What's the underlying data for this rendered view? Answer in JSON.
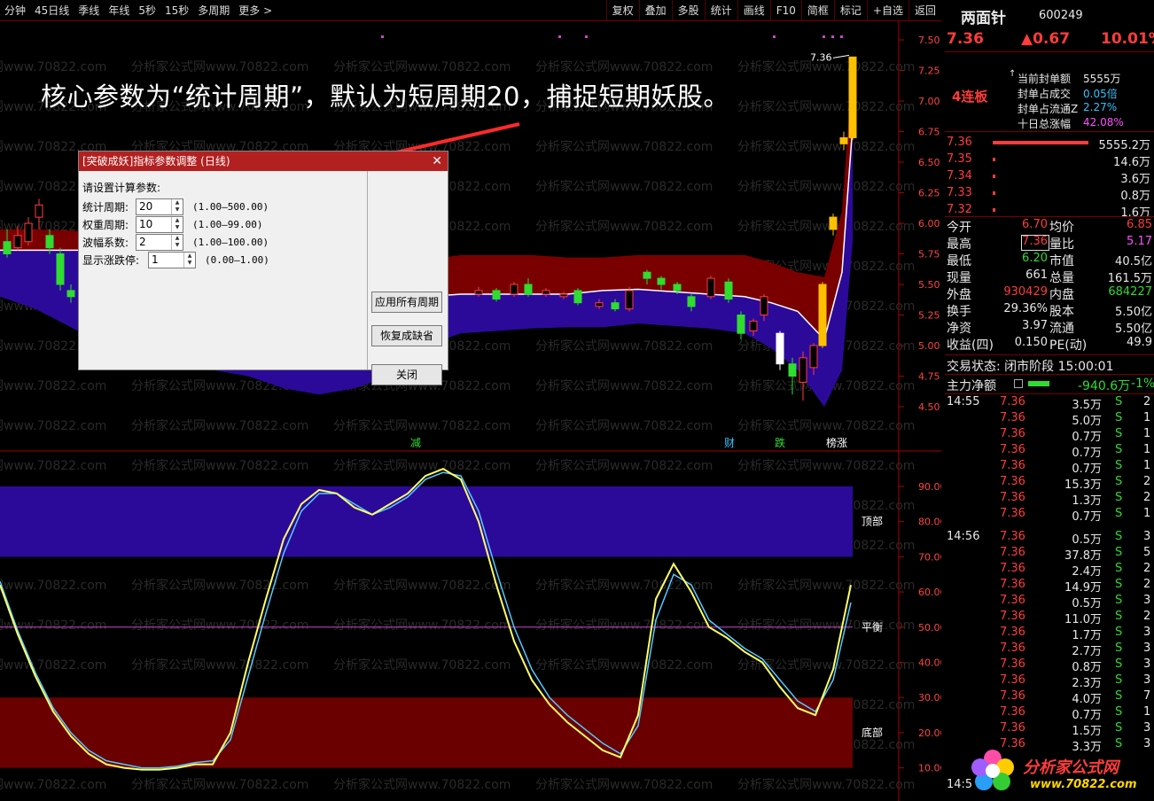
{
  "toolbar": {
    "left": [
      "分钟",
      "45日线",
      "季线",
      "年线",
      "5秒",
      "15秒",
      "多周期",
      "更多 >"
    ],
    "right": [
      "复权",
      "叠加",
      "多股",
      "统计",
      "画线",
      "F10",
      "简框",
      "标记",
      "+自选",
      "返回"
    ]
  },
  "caption": "核心参数为“统计周期”，默认为短周期20，捕捉短期妖股。",
  "watermark": "分析家公式网www.70822.com",
  "price_axis": [
    "7.50",
    "7.25",
    "7.00",
    "6.75",
    "6.50",
    "6.25",
    "6.00",
    "5.75",
    "5.50",
    "5.25",
    "5.00",
    "4.75",
    "4.50"
  ],
  "osc_axis": [
    "90.00",
    "80.00",
    "70.00",
    "60.00",
    "50.00",
    "40.00",
    "30.00",
    "20.00",
    "10.00"
  ],
  "osc_labels": {
    "top": "顶部",
    "mid": "平衡",
    "bottom": "底部"
  },
  "price_tag": "7.36",
  "signals": [
    {
      "text": "减",
      "color": "#2fdc2f"
    },
    {
      "text": "财",
      "color": "#33c3ff"
    },
    {
      "text": "跌",
      "color": "#2fdc2f"
    },
    {
      "text": "榜涨",
      "color": "#ffffff"
    }
  ],
  "dialog": {
    "title": "[突破成妖]指标参数调整 (日线)",
    "close": "✕",
    "prompt": "请设置计算参数:",
    "params": [
      {
        "label": "统计周期:",
        "value": "20",
        "range": "(1.00—500.00)"
      },
      {
        "label": "权重周期:",
        "value": "10",
        "range": "(1.00—99.00)"
      },
      {
        "label": "波幅系数:",
        "value": "2",
        "range": "(1.00—100.00)"
      },
      {
        "label": "显示涨跌停:",
        "value": "1",
        "range": "(0.00—1.00)"
      }
    ],
    "buttons": [
      "应用所有周期",
      "恢复成缺省",
      "关闭"
    ]
  },
  "stock": {
    "name": "两面针",
    "code": "600249",
    "price": "7.36",
    "change": "▲0.67",
    "pct": "10.01%",
    "board": "4连板",
    "seal": [
      {
        "label": "当前封单额",
        "value": "5555万",
        "color": "#e8e8e8"
      },
      {
        "label": "封单占成交",
        "value": "0.05倍",
        "color": "#33c3ff"
      },
      {
        "label": "封单占流通Z",
        "value": "2.27%",
        "color": "#33c3ff"
      },
      {
        "label": "十日总涨幅",
        "value": "42.08%",
        "color": "#ff50ff"
      }
    ],
    "orderbook": [
      {
        "price": "7.36",
        "vol": "5555.2万"
      },
      {
        "price": "7.35",
        "vol": "14.6万"
      },
      {
        "price": "7.34",
        "vol": "3.6万"
      },
      {
        "price": "7.33",
        "vol": "0.8万"
      },
      {
        "price": "7.32",
        "vol": "1.6万"
      }
    ],
    "stats": [
      [
        {
          "l": "今开",
          "v": "6.70",
          "c": "#ff3c3c"
        },
        {
          "l": "均价",
          "v": "6.85",
          "c": "#ff3c3c"
        }
      ],
      [
        {
          "l": "最高",
          "v": "7.36",
          "c": "#ff3c3c"
        },
        {
          "l": "量比",
          "v": "5.17",
          "c": "#ff50ff"
        }
      ],
      [
        {
          "l": "最低",
          "v": "6.20",
          "c": "#2fdc2f"
        },
        {
          "l": "市值",
          "v": "40.5亿",
          "c": "#e8e8e8"
        }
      ],
      [
        {
          "l": "现量",
          "v": "661",
          "c": "#e8e8e8"
        },
        {
          "l": "总量",
          "v": "161.5万",
          "c": "#e8e8e8"
        }
      ],
      [
        {
          "l": "外盘",
          "v": "930429",
          "c": "#ff3c3c"
        },
        {
          "l": "内盘",
          "v": "684227",
          "c": "#2fdc2f"
        }
      ],
      [
        {
          "l": "换手",
          "v": "29.36%",
          "c": "#e8e8e8"
        },
        {
          "l": "股本",
          "v": "5.50亿",
          "c": "#e8e8e8"
        }
      ],
      [
        {
          "l": "净资",
          "v": "3.97",
          "c": "#e8e8e8"
        },
        {
          "l": "流通",
          "v": "5.50亿",
          "c": "#e8e8e8"
        }
      ],
      [
        {
          "l": "收益(四)",
          "v": "0.150",
          "c": "#e8e8e8"
        },
        {
          "l": "PE(动)",
          "v": "49.9",
          "c": "#e8e8e8"
        }
      ]
    ],
    "trade_status": "交易状态: 闭市阶段 15:00:01",
    "main_flow": {
      "label": "主力净额",
      "value": "-940.6万",
      "pct": "-1%"
    },
    "ticks": [
      {
        "t": "14:55",
        "p": "7.36",
        "v": "3.5万",
        "s": "S",
        "n": "2"
      },
      {
        "t": "",
        "p": "7.36",
        "v": "5.0万",
        "s": "S",
        "n": "1"
      },
      {
        "t": "",
        "p": "7.36",
        "v": "0.7万",
        "s": "S",
        "n": "1"
      },
      {
        "t": "",
        "p": "7.36",
        "v": "0.7万",
        "s": "S",
        "n": "1"
      },
      {
        "t": "",
        "p": "7.36",
        "v": "0.7万",
        "s": "S",
        "n": "1"
      },
      {
        "t": "",
        "p": "7.36",
        "v": "15.3万",
        "s": "S",
        "n": "2"
      },
      {
        "t": "",
        "p": "7.36",
        "v": "1.3万",
        "s": "S",
        "n": "2"
      },
      {
        "t": "",
        "p": "7.36",
        "v": "0.7万",
        "s": "S",
        "n": "1"
      },
      {
        "t": "14:56",
        "p": "7.36",
        "v": "0.5万",
        "s": "S",
        "n": "3"
      },
      {
        "t": "",
        "p": "7.36",
        "v": "37.8万",
        "s": "S",
        "n": "5"
      },
      {
        "t": "",
        "p": "7.36",
        "v": "2.4万",
        "s": "S",
        "n": "2"
      },
      {
        "t": "",
        "p": "7.36",
        "v": "14.9万",
        "s": "S",
        "n": "2"
      },
      {
        "t": "",
        "p": "7.36",
        "v": "0.5万",
        "s": "S",
        "n": "3"
      },
      {
        "t": "",
        "p": "7.36",
        "v": "11.0万",
        "s": "S",
        "n": "2"
      },
      {
        "t": "",
        "p": "7.36",
        "v": "1.7万",
        "s": "S",
        "n": "3"
      },
      {
        "t": "",
        "p": "7.36",
        "v": "2.7万",
        "s": "S",
        "n": "3"
      },
      {
        "t": "",
        "p": "7.36",
        "v": "0.8万",
        "s": "S",
        "n": "3"
      },
      {
        "t": "",
        "p": "7.36",
        "v": "2.3万",
        "s": "S",
        "n": "3"
      },
      {
        "t": "",
        "p": "7.36",
        "v": "4.0万",
        "s": "S",
        "n": "7"
      },
      {
        "t": "",
        "p": "7.36",
        "v": "0.7万",
        "s": "S",
        "n": "1"
      },
      {
        "t": "",
        "p": "7.36",
        "v": "1.5万",
        "s": "S",
        "n": "3"
      },
      {
        "t": "",
        "p": "7.36",
        "v": "3.3万",
        "s": "S",
        "n": "3"
      }
    ],
    "last_tick_time": "14:5"
  },
  "logo": {
    "name": "分析家公式网",
    "url": "www.70822.com"
  }
}
